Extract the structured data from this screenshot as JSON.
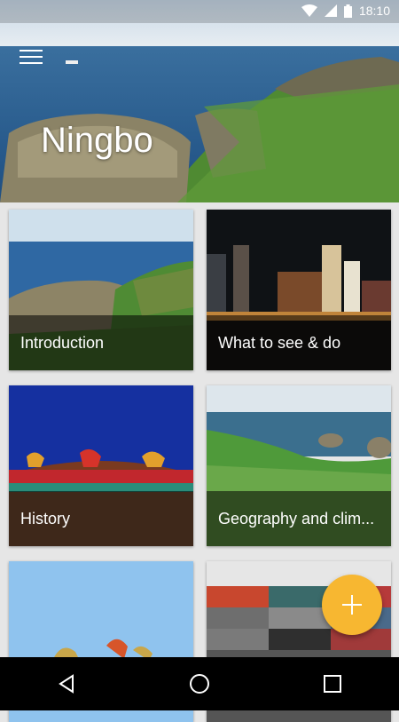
{
  "status_bar": {
    "time": "18:10"
  },
  "hero": {
    "title": "Ningbo"
  },
  "cards": [
    {
      "label": "Introduction"
    },
    {
      "label": "What to see & do"
    },
    {
      "label": "History"
    },
    {
      "label": "Geography and clim..."
    },
    {
      "label": ""
    },
    {
      "label": ""
    }
  ],
  "colors": {
    "fab": "#f7b731",
    "navbar": "#000000"
  },
  "icons": [
    "wifi-icon",
    "signal-icon",
    "battery-icon",
    "menu-icon",
    "add-icon",
    "back-icon",
    "home-icon",
    "recents-icon"
  ]
}
